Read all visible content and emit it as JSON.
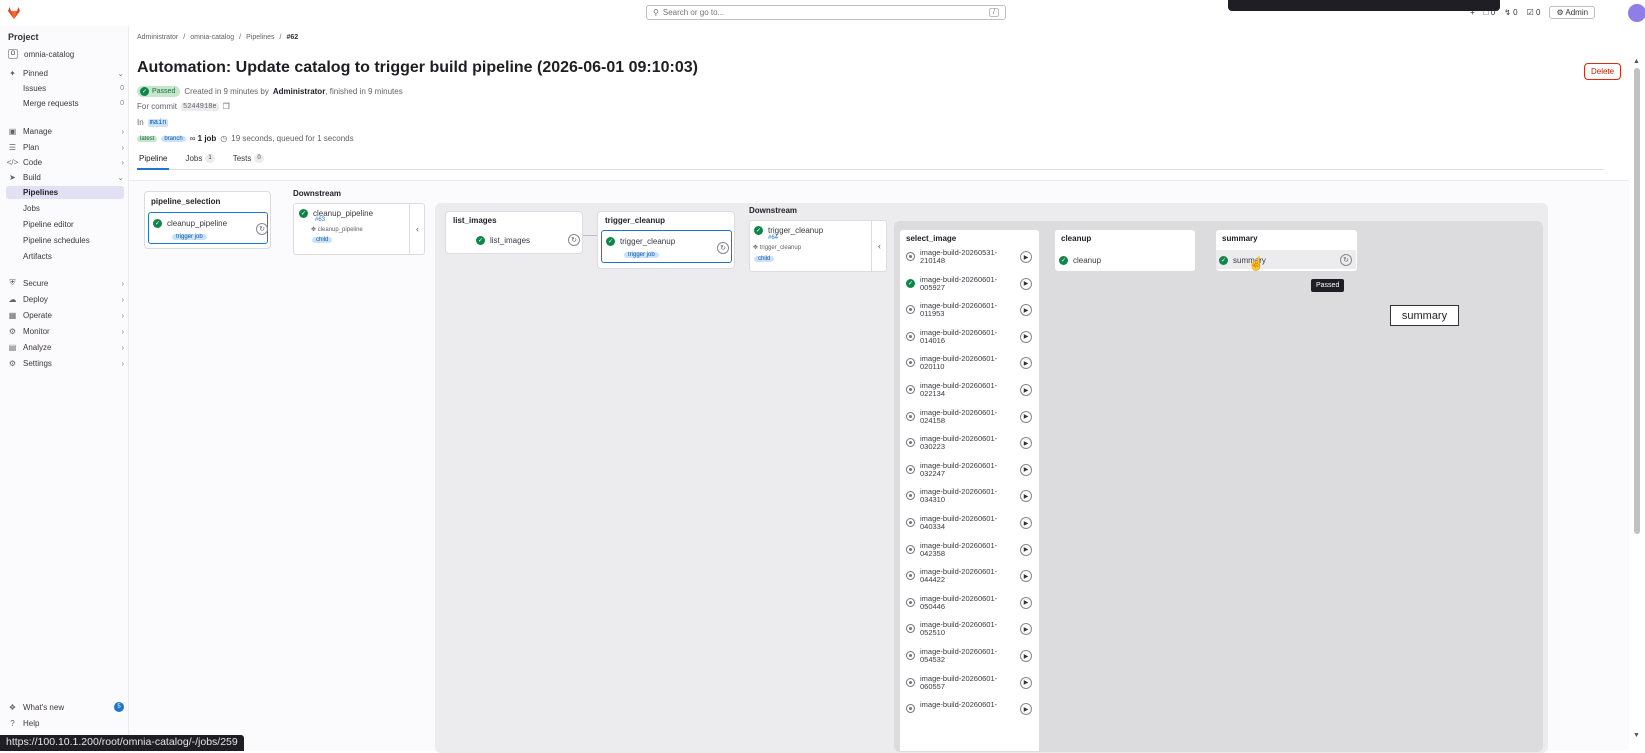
{
  "topbar": {
    "search_placeholder": "Search or go to...",
    "search_shortcut": "/",
    "counts": [
      "0",
      "0",
      "0"
    ],
    "admin_label": "Admin"
  },
  "sidebar": {
    "heading": "Project",
    "project_initial": "O",
    "project_name": "omnia-catalog",
    "pinned": "Pinned",
    "issues": "Issues",
    "issues_count": "0",
    "merge_requests": "Merge requests",
    "mr_count": "0",
    "items": [
      "Manage",
      "Plan",
      "Code",
      "Build"
    ],
    "build_sub": [
      "Pipelines",
      "Jobs",
      "Pipeline editor",
      "Pipeline schedules",
      "Artifacts"
    ],
    "items2": [
      "Secure",
      "Deploy",
      "Operate",
      "Monitor",
      "Analyze",
      "Settings"
    ],
    "whats_new": "What's new",
    "whats_new_count": "5",
    "help": "Help"
  },
  "breadcrumbs": [
    "Administrator",
    "omnia-catalog",
    "Pipelines",
    "#62"
  ],
  "title": "Automation: Update catalog to trigger build pipeline (2026-06-01 09:10:03)",
  "delete_label": "Delete",
  "meta": {
    "status": "Passed",
    "created": "Created in 9 minutes by",
    "user": "Administrator",
    "finished": ", finished in 9 minutes",
    "for_commit": "For commit",
    "commit": "5244918e",
    "in_label": "In",
    "branch": "main",
    "tag_latest": "latest",
    "tag_branch": "branch",
    "jobs": "1 job",
    "duration": "19 seconds, queued for 1 seconds"
  },
  "tabs": [
    {
      "label": "Pipeline",
      "count": ""
    },
    {
      "label": "Jobs",
      "count": "1"
    },
    {
      "label": "Tests",
      "count": "0"
    }
  ],
  "graph": {
    "pipeline_selection": {
      "title": "pipeline_selection",
      "job": "cleanup_pipeline",
      "tag": "trigger job"
    },
    "downstream1": {
      "title": "Downstream",
      "name": "cleanup_pipeline",
      "num": "#63",
      "sub": "cleanup_pipeline",
      "tag": "child"
    },
    "list_images": {
      "title": "list_images",
      "job": "list_images"
    },
    "trigger_cleanup": {
      "title": "trigger_cleanup",
      "job": "trigger_cleanup",
      "tag": "trigger job"
    },
    "downstream2": {
      "title": "Downstream",
      "name": "trigger_cleanup",
      "num": "#64",
      "sub": "trigger_cleanup",
      "tag": "child"
    },
    "select_image": {
      "title": "select_image",
      "jobs": [
        [
          "image-build-20260531-",
          "210148"
        ],
        [
          "image-build-20260601-",
          "005927"
        ],
        [
          "image-build-20260601-",
          "011953"
        ],
        [
          "image-build-20260601-",
          "014016"
        ],
        [
          "image-build-20260601-",
          "020110"
        ],
        [
          "image-build-20260601-",
          "022134"
        ],
        [
          "image-build-20260601-",
          "024158"
        ],
        [
          "image-build-20260601-",
          "030223"
        ],
        [
          "image-build-20260601-",
          "032247"
        ],
        [
          "image-build-20260601-",
          "034310"
        ],
        [
          "image-build-20260601-",
          "040334"
        ],
        [
          "image-build-20260601-",
          "042358"
        ],
        [
          "image-build-20260601-",
          "044422"
        ],
        [
          "image-build-20260601-",
          "050446"
        ],
        [
          "image-build-20260601-",
          "052510"
        ],
        [
          "image-build-20260601-",
          "054532"
        ],
        [
          "image-build-20260601-",
          "060557"
        ],
        [
          "image-build-20260601-",
          ""
        ]
      ]
    },
    "cleanup": {
      "title": "cleanup",
      "job": "cleanup"
    },
    "summary": {
      "title": "summary",
      "job": "summary"
    }
  },
  "tooltip": "Passed",
  "popup": "summary",
  "status_url": "https://100.10.1.200/root/omnia-catalog/-/jobs/259"
}
